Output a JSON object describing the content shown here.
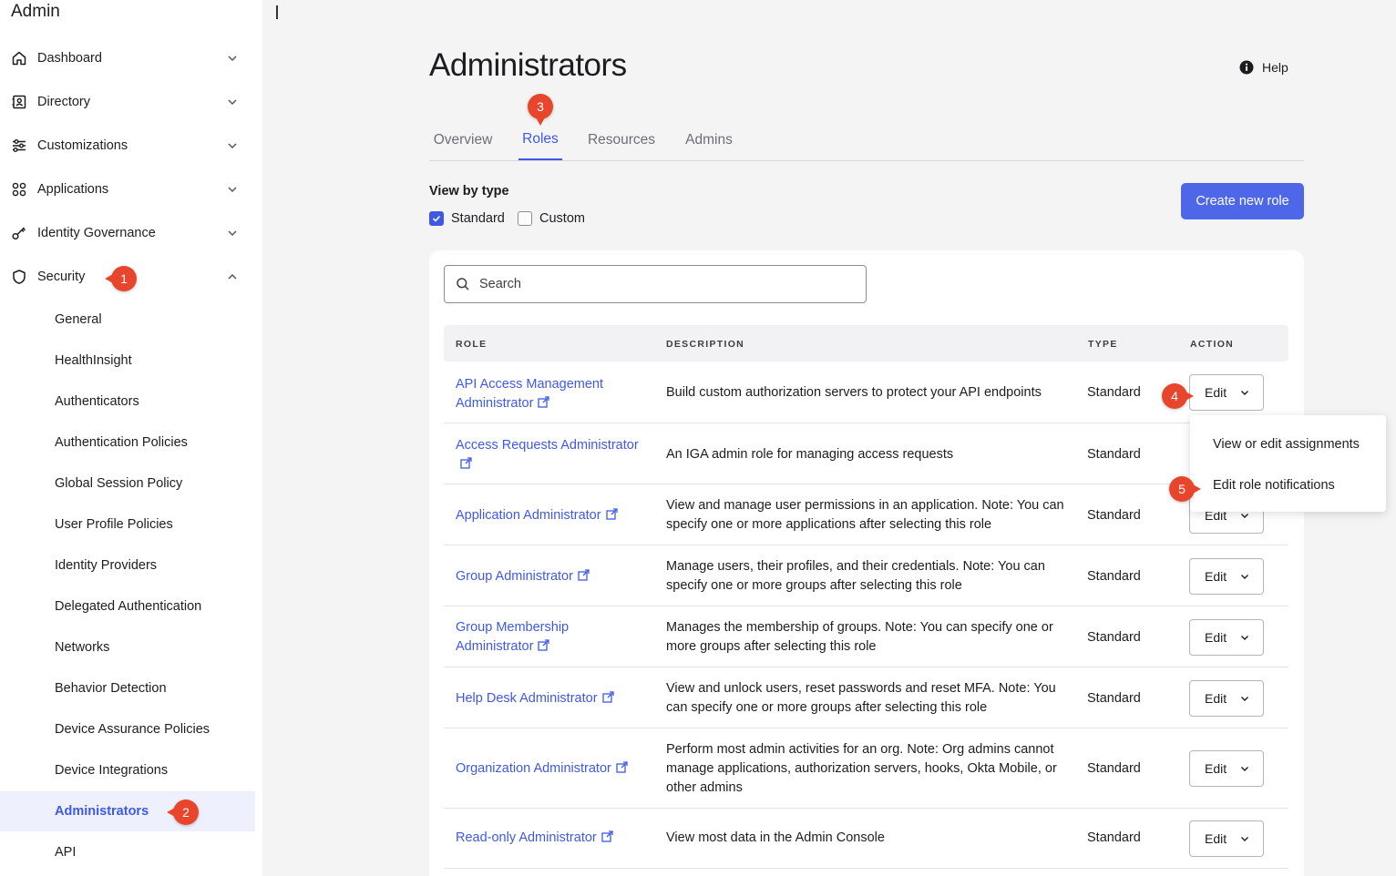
{
  "app": {
    "title": "Admin"
  },
  "sidebar": {
    "items": [
      {
        "label": "Dashboard",
        "icon": "home-icon"
      },
      {
        "label": "Directory",
        "icon": "directory-icon"
      },
      {
        "label": "Customizations",
        "icon": "sliders-icon"
      },
      {
        "label": "Applications",
        "icon": "apps-grid-icon"
      },
      {
        "label": "Identity Governance",
        "icon": "key-icon"
      },
      {
        "label": "Security",
        "icon": "shield-icon",
        "expanded": true
      }
    ],
    "security_sub": [
      "General",
      "HealthInsight",
      "Authenticators",
      "Authentication Policies",
      "Global Session Policy",
      "User Profile Policies",
      "Identity Providers",
      "Delegated Authentication",
      "Networks",
      "Behavior Detection",
      "Device Assurance Policies",
      "Device Integrations",
      "Administrators",
      "API"
    ],
    "active_sub": "Administrators"
  },
  "markers": [
    "1",
    "2",
    "3",
    "4",
    "5"
  ],
  "main": {
    "title": "Administrators",
    "help": "Help",
    "tabs": [
      "Overview",
      "Roles",
      "Resources",
      "Admins"
    ],
    "active_tab": "Roles",
    "view_by_type": "View by type",
    "filters": [
      {
        "label": "Standard",
        "checked": true
      },
      {
        "label": "Custom",
        "checked": false
      }
    ],
    "create_button": "Create new role",
    "search": {
      "placeholder": "Search"
    },
    "table": {
      "headers": [
        "ROLE",
        "DESCRIPTION",
        "TYPE",
        "ACTION"
      ],
      "rows": [
        {
          "role": "API Access Management Administrator",
          "desc": "Build custom authorization servers to protect your API endpoints",
          "type": "Standard",
          "action": "Edit"
        },
        {
          "role": "Access Requests Administrator",
          "desc": "An IGA admin role for managing access requests",
          "type": "Standard",
          "action": "Edit"
        },
        {
          "role": "Application Administrator",
          "desc": "View and manage user permissions in an application. Note: You can specify one or more applications after selecting this role",
          "type": "Standard",
          "action": "Edit"
        },
        {
          "role": "Group Administrator",
          "desc": "Manage users, their profiles, and their credentials. Note: You can specify one or more groups after selecting this role",
          "type": "Standard",
          "action": "Edit"
        },
        {
          "role": "Group Membership Administrator",
          "desc": "Manages the membership of groups. Note: You can specify one or more groups after selecting this role",
          "type": "Standard",
          "action": "Edit"
        },
        {
          "role": "Help Desk Administrator",
          "desc": "View and unlock users, reset passwords and reset MFA. Note: You can specify one or more groups after selecting this role",
          "type": "Standard",
          "action": "Edit"
        },
        {
          "role": "Organization Administrator",
          "desc": "Perform most admin activities for an org. Note: Org admins cannot manage applications, authorization servers, hooks, Okta Mobile, or other admins",
          "type": "Standard",
          "action": "Edit"
        },
        {
          "role": "Read-only Administrator",
          "desc": "View most data in the Admin Console",
          "type": "Standard",
          "action": "Edit"
        }
      ]
    },
    "edit_menu": [
      "View or edit assignments",
      "Edit role notifications"
    ]
  },
  "colors": {
    "accent": "#3f59e4",
    "primary_button": "#4e66e8",
    "marker": "#e8452d"
  }
}
